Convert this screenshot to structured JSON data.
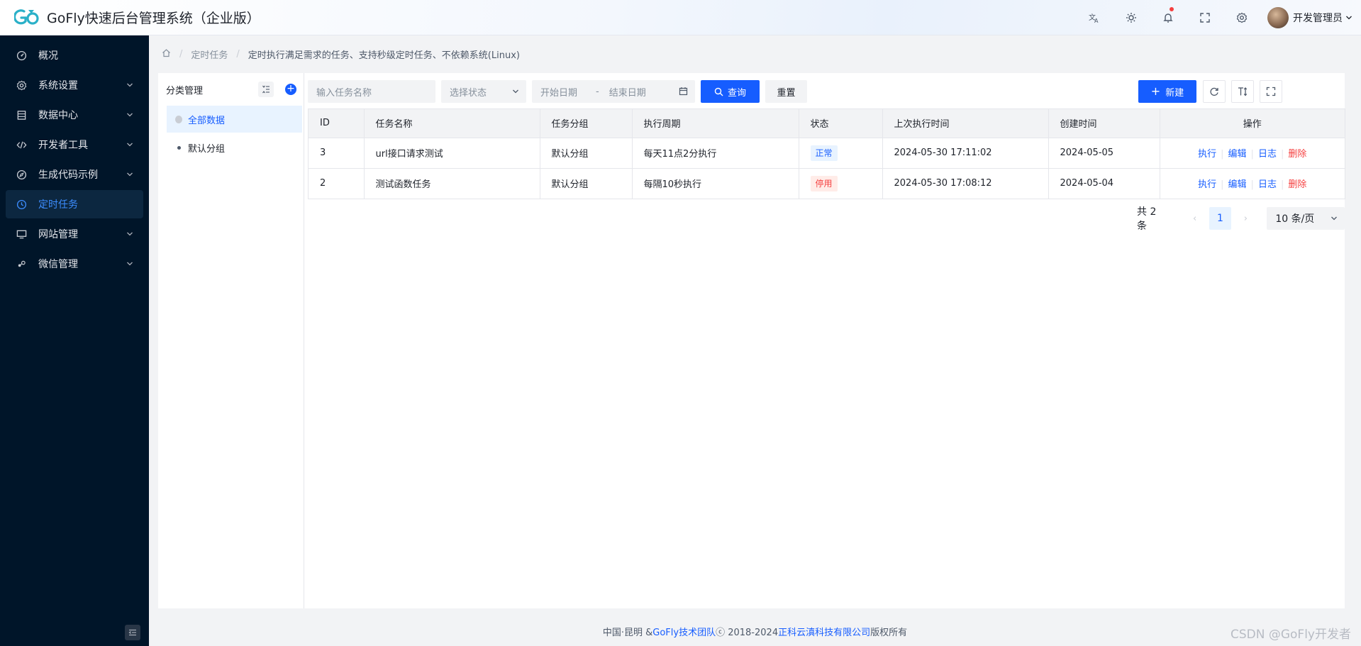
{
  "app": {
    "title": "GoFly快速后台管理系统（企业版）",
    "user_name": "开发管理员"
  },
  "header_icons": [
    "translate-icon",
    "theme-icon",
    "bell-icon",
    "fullscreen-icon",
    "settings-icon"
  ],
  "sidebar": {
    "items": [
      {
        "label": "概况",
        "icon": "dashboard-icon",
        "has_children": false,
        "active": false
      },
      {
        "label": "系统设置",
        "icon": "gear-icon",
        "has_children": true,
        "active": false
      },
      {
        "label": "数据中心",
        "icon": "database-icon",
        "has_children": true,
        "active": false
      },
      {
        "label": "开发者工具",
        "icon": "code-icon",
        "has_children": true,
        "active": false
      },
      {
        "label": "生成代码示例",
        "icon": "compass-icon",
        "has_children": true,
        "active": false
      },
      {
        "label": "定时任务",
        "icon": "clock-icon",
        "has_children": false,
        "active": true
      },
      {
        "label": "网站管理",
        "icon": "monitor-icon",
        "has_children": true,
        "active": false
      },
      {
        "label": "微信管理",
        "icon": "wechat-icon",
        "has_children": true,
        "active": false
      }
    ]
  },
  "breadcrumb": {
    "level1": "定时任务",
    "level2": "定时执行满足需求的任务、支持秒级定时任务、不依赖系统(Linux)"
  },
  "category": {
    "title": "分类管理",
    "items": [
      {
        "label": "全部数据",
        "active": true
      },
      {
        "label": "默认分组",
        "active": false
      }
    ]
  },
  "search": {
    "name_placeholder": "输入任务名称",
    "status_placeholder": "选择状态",
    "start_date_placeholder": "开始日期",
    "end_date_placeholder": "结束日期",
    "date_separator": "-",
    "query_label": "查询",
    "reset_label": "重置",
    "new_label": "新建"
  },
  "table": {
    "columns": [
      "ID",
      "任务名称",
      "任务分组",
      "执行周期",
      "状态",
      "上次执行时间",
      "创建时间",
      "操作"
    ],
    "rows": [
      {
        "id": "3",
        "name": "url接口请求测试",
        "group": "默认分组",
        "cycle": "每天11点2分执行",
        "status": "正常",
        "last_run": "2024-05-30 17:11:02",
        "created": "2024-05-05"
      },
      {
        "id": "2",
        "name": "测试函数任务",
        "group": "默认分组",
        "cycle": "每隔10秒执行",
        "status": "停用",
        "last_run": "2024-05-30 17:08:12",
        "created": "2024-05-04"
      }
    ],
    "actions": {
      "run": "执行",
      "edit": "编辑",
      "log": "日志",
      "delete": "删除"
    }
  },
  "pagination": {
    "total_text": "共 2 条",
    "current_page": "1",
    "page_size": "10 条/页"
  },
  "footer": {
    "prefix": "中国·昆明 & ",
    "team": "GoFly技术团队",
    "copyright": " ⓒ 2018-2024 ",
    "company": "正科云滇科技有限公司",
    "suffix": " 版权所有"
  },
  "watermark": "CSDN @GoFly开发者",
  "colors": {
    "primary": "#165dff",
    "sidebar_bg": "#001529",
    "danger": "#f53f3f"
  }
}
